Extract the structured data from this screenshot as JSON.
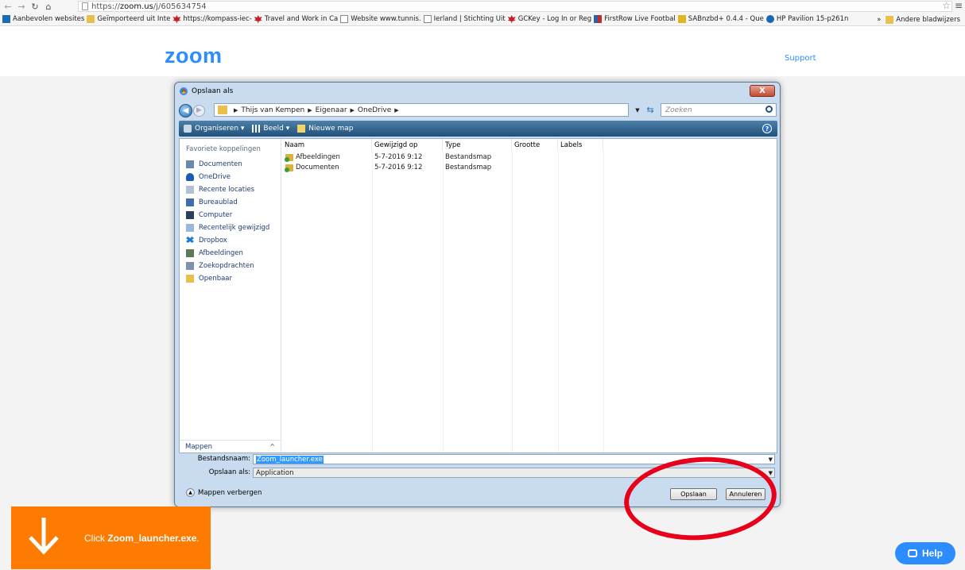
{
  "browser": {
    "url_prefix": "https://",
    "url_host": "zoom.us",
    "url_path": "/j/605634754",
    "bookmarks": [
      {
        "label": "Aanbevolen websites",
        "icon": "blue"
      },
      {
        "label": "Geïmporteerd uit Inte",
        "icon": "folder"
      },
      {
        "label": "https://kompass-iec-",
        "icon": "leaf"
      },
      {
        "label": "Travel and Work in Ca",
        "icon": "leaf"
      },
      {
        "label": "Website www.tunnis.",
        "icon": "page"
      },
      {
        "label": "Ierland | Stichting Uit",
        "icon": "page"
      },
      {
        "label": "GCKey - Log In or Reg",
        "icon": "leaf"
      },
      {
        "label": "FirstRow Live Footbal",
        "icon": "flag"
      },
      {
        "label": "SABnzbd+ 0.4.4 - Que",
        "icon": "sab"
      },
      {
        "label": "HP Pavilion 15-p261n",
        "icon": "hp"
      }
    ],
    "more_label": "»",
    "other_bookmarks": "Andere bladwijzers"
  },
  "zoom": {
    "logo": "zoom",
    "support": "Support"
  },
  "dialog": {
    "title": "Opslaan als",
    "close": "X",
    "path": [
      "Thijs van Kempen",
      "Eigenaar",
      "OneDrive"
    ],
    "search_placeholder": "Zoeken",
    "toolbar": {
      "organize": "Organiseren ▾",
      "view": "Beeld ▾",
      "new_folder": "Nieuwe map"
    },
    "sidebar_title": "Favoriete koppelingen",
    "sidebar_items": [
      {
        "label": "Documenten",
        "icon": "doc"
      },
      {
        "label": "OneDrive",
        "icon": "cloud"
      },
      {
        "label": "Recente locaties",
        "icon": "recent"
      },
      {
        "label": "Bureaublad",
        "icon": "desk"
      },
      {
        "label": "Computer",
        "icon": "comp"
      },
      {
        "label": "Recentelijk gewijzigd",
        "icon": "rec"
      },
      {
        "label": "Dropbox",
        "icon": "drop"
      },
      {
        "label": "Afbeeldingen",
        "icon": "img"
      },
      {
        "label": "Zoekopdrachten",
        "icon": "srch"
      },
      {
        "label": "Openbaar",
        "icon": "pub"
      }
    ],
    "sidebar_footer": "Mappen",
    "columns": [
      "Naam",
      "Gewijzigd op",
      "Type",
      "Grootte",
      "Labels"
    ],
    "files": [
      {
        "name": "Afbeeldingen",
        "modified": "5-7-2016 9:12",
        "type": "Bestandsmap"
      },
      {
        "name": "Documenten",
        "modified": "5-7-2016 9:12",
        "type": "Bestandsmap"
      }
    ],
    "filename_label": "Bestandsnaam:",
    "filename_value": "Zoom_launcher.exe",
    "savetype_label": "Opslaan als:",
    "savetype_value": "Application",
    "hide_folders": "Mappen verbergen",
    "save_button": "Opslaan",
    "cancel_button": "Annuleren"
  },
  "banner": {
    "prefix": "Click ",
    "filename": "Zoom_launcher.exe",
    "suffix": "."
  },
  "help_button": "Help",
  "colors": {
    "zoom_blue": "#2d8cff",
    "banner_orange": "#fd7b00",
    "annotation_red": "#e8001a"
  }
}
